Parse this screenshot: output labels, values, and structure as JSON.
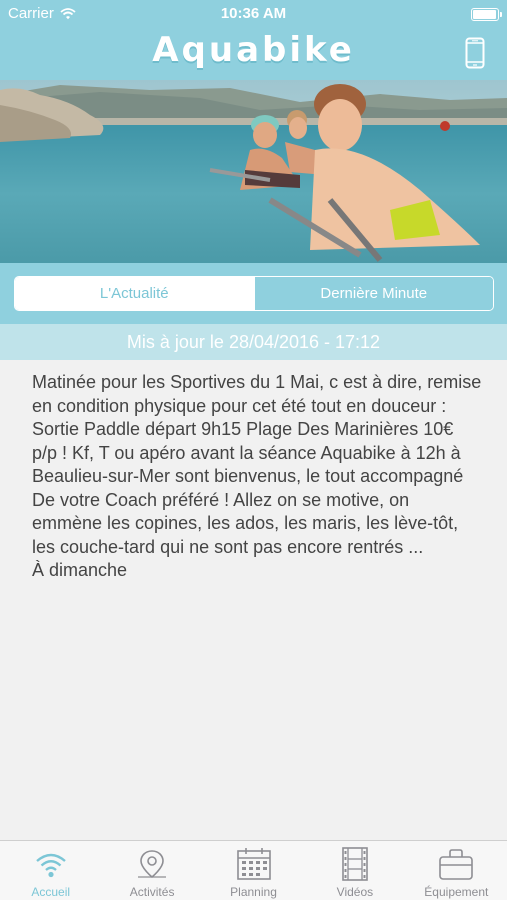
{
  "status_bar": {
    "carrier": "Carrier",
    "time": "10:36 AM",
    "battery_level": 1.0
  },
  "header": {
    "title": "Aquabike"
  },
  "segments": [
    {
      "label": "L'Actualité",
      "active": true
    },
    {
      "label": "Dernière Minute",
      "active": false
    }
  ],
  "update": {
    "text": "Mis à jour le 28/04/2016 - 17:12"
  },
  "article": {
    "body": "Matinée pour les Sportives du 1 Mai, c est à dire, remise en condition physique pour cet été tout en douceur : Sortie Paddle départ 9h15  Plage Des Marinières 10€ p/p ! Kf, T ou apéro avant la séance Aquabike à 12h à Beaulieu-sur-Mer  sont bienvenus, le tout accompagné De votre Coach préféré  ! Allez on se motive, on emmène les copines, les ados, les maris, les lève-tôt, les couche-tard qui ne sont pas encore rentrés ...\nÀ dimanche"
  },
  "tabs": [
    {
      "label": "Accueil",
      "icon": "wifi-icon",
      "active": true
    },
    {
      "label": "Activités",
      "icon": "map-pin-icon",
      "active": false
    },
    {
      "label": "Planning",
      "icon": "calendar-icon",
      "active": false
    },
    {
      "label": "Vidéos",
      "icon": "film-icon",
      "active": false
    },
    {
      "label": "Équipement",
      "icon": "bag-icon",
      "active": false
    }
  ],
  "colors": {
    "primary": "#8fd0de",
    "accent": "#7cc6d6",
    "update_bar": "#bfe3ea",
    "background": "#f1f1f1"
  }
}
